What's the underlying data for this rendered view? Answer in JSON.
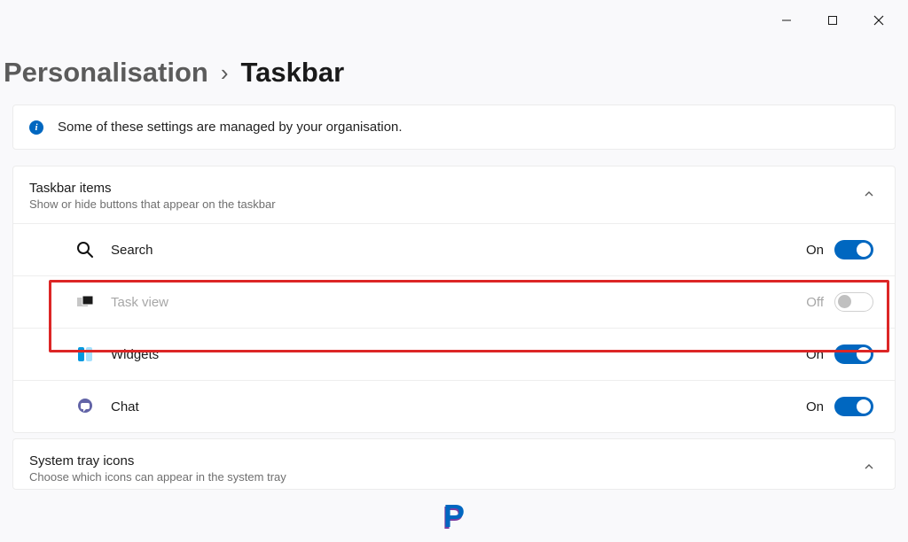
{
  "breadcrumb": {
    "parent": "Personalisation",
    "current": "Taskbar"
  },
  "banner": {
    "text": "Some of these settings are managed by your organisation."
  },
  "section_items": {
    "title": "Taskbar items",
    "subtitle": "Show or hide buttons that appear on the taskbar",
    "rows": [
      {
        "label": "Search",
        "state": "On",
        "on": true,
        "disabled": false
      },
      {
        "label": "Task view",
        "state": "Off",
        "on": false,
        "disabled": true
      },
      {
        "label": "Widgets",
        "state": "On",
        "on": true,
        "disabled": false
      },
      {
        "label": "Chat",
        "state": "On",
        "on": true,
        "disabled": false
      }
    ]
  },
  "section_tray": {
    "title": "System tray icons",
    "subtitle": "Choose which icons can appear in the system tray"
  },
  "watermark_letter": "P"
}
